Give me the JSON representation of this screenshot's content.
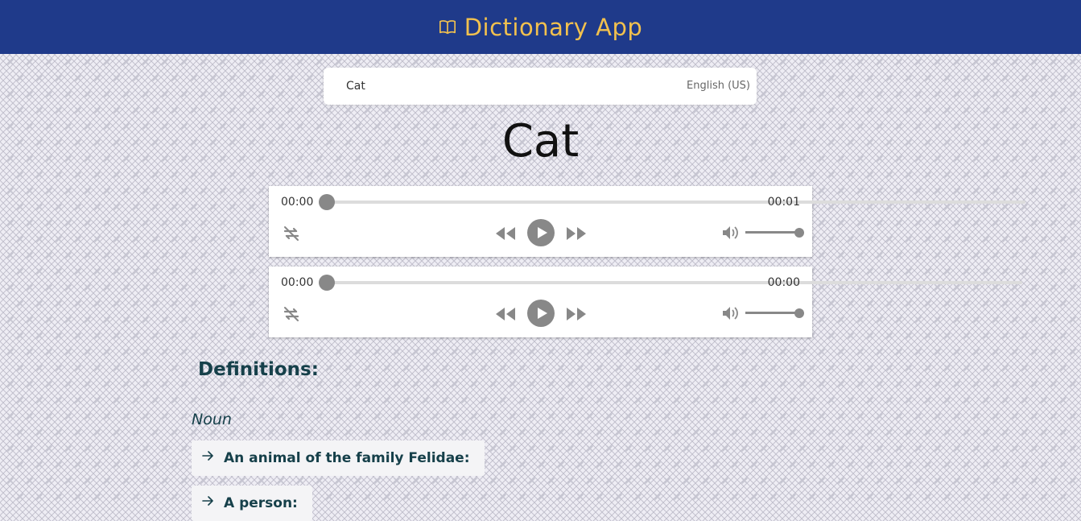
{
  "header": {
    "title": "Dictionary App",
    "icon": "book-icon",
    "background": "#1f3a8a",
    "accent": "#f2c14e"
  },
  "search": {
    "value": "Cat",
    "placeholder": "",
    "language": "English (US)"
  },
  "word": {
    "title": "Cat"
  },
  "players": [
    {
      "time_current": "00:00",
      "time_total": "00:01",
      "progress": 0,
      "volume": 1.0
    },
    {
      "time_current": "00:00",
      "time_total": "00:00",
      "progress": 0,
      "volume": 1.0
    }
  ],
  "player_icons": [
    "loop-icon",
    "rewind-icon",
    "play-icon",
    "forward-icon",
    "volume-icon"
  ],
  "definitions": {
    "heading": "Definitions:",
    "part_of_speech": "Noun",
    "items": [
      {
        "text": "An animal of the family Felidae:"
      },
      {
        "text": "A person:"
      }
    ]
  }
}
